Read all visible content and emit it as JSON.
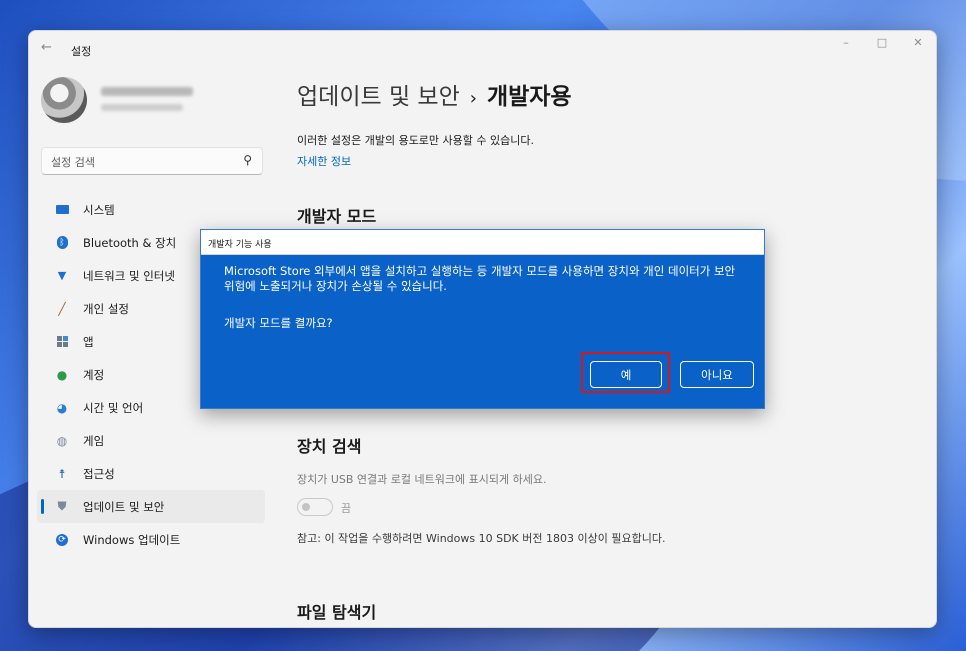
{
  "window": {
    "title": "설정",
    "controls": {
      "minimize": "–",
      "maximize": "□",
      "close": "✕"
    }
  },
  "sidebar": {
    "search_placeholder": "설정 검색",
    "items": [
      {
        "label": "시스템",
        "icon": "monitor-icon"
      },
      {
        "label": "Bluetooth & 장치",
        "icon": "bluetooth-icon"
      },
      {
        "label": "네트워크 및 인터넷",
        "icon": "wifi-icon"
      },
      {
        "label": "개인 설정",
        "icon": "brush-icon"
      },
      {
        "label": "앱",
        "icon": "apps-icon"
      },
      {
        "label": "계정",
        "icon": "person-icon"
      },
      {
        "label": "시간 및 언어",
        "icon": "globe-clock-icon"
      },
      {
        "label": "게임",
        "icon": "gamepad-icon"
      },
      {
        "label": "접근성",
        "icon": "accessibility-icon"
      },
      {
        "label": "업데이트 및 보안",
        "icon": "shield-icon",
        "active": true
      },
      {
        "label": "Windows 업데이트",
        "icon": "sync-icon"
      }
    ]
  },
  "main": {
    "breadcrumb_parent": "업데이트 및 보안",
    "breadcrumb_separator": "›",
    "breadcrumb_current": "개발자용",
    "intro_text": "이러한 설정은 개발의 용도로만 사용할 수 있습니다.",
    "more_info_link": "자세한 정보",
    "section_developer_mode": "개발자 모드",
    "section_device_discovery": "장치 검색",
    "device_discovery_desc": "장치가 USB 연결과 로컬 네트워크에 표시되게 하세요.",
    "toggle_state_label": "끔",
    "note_text": "참고: 이 작업을 수행하려면 Windows 10 SDK 버전 1803 이상이 필요합니다.",
    "section_file_explorer": "파일 탐색기"
  },
  "dialog": {
    "title": "개발자 기능 사용",
    "message": "Microsoft Store 외부에서 앱을 설치하고 실행하는 등 개발자 모드를 사용하면 장치와 개인 데이터가 보안 위험에 노출되거나 장치가 손상될 수 있습니다.",
    "question": "개발자 모드를 켤까요?",
    "yes_label": "예",
    "no_label": "아니요"
  },
  "colors": {
    "accent": "#0067c0",
    "dialog_bg": "#0a62c8",
    "highlight": "#d21a1a"
  }
}
